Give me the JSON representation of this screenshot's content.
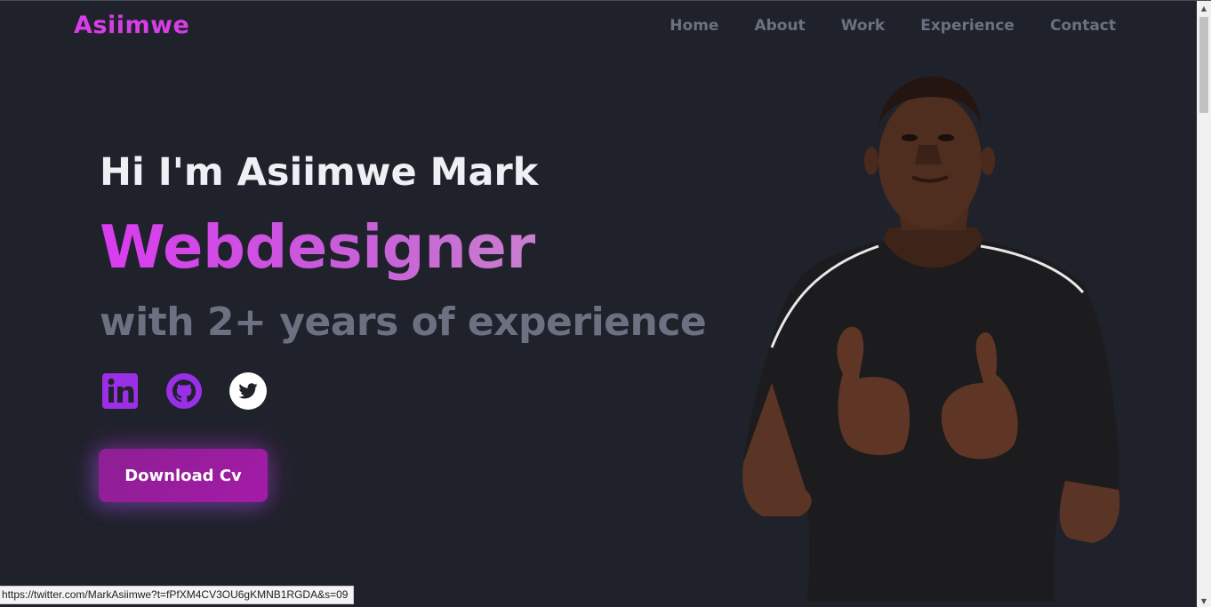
{
  "brand": {
    "logo": "Asiimwe"
  },
  "nav": [
    {
      "label": "Home"
    },
    {
      "label": "About"
    },
    {
      "label": "Work"
    },
    {
      "label": "Experience"
    },
    {
      "label": "Contact"
    }
  ],
  "hero": {
    "greeting": "Hi I'm Asiimwe Mark",
    "role": "Webdesigner",
    "subtitle": "with 2+ years of experience"
  },
  "socials": [
    {
      "icon": "linkedin-icon",
      "color": "#9b2fe8"
    },
    {
      "icon": "github-icon",
      "color": "#9b2fe8"
    },
    {
      "icon": "twitter-icon",
      "color": "#ffffff"
    }
  ],
  "cta": {
    "label": "Download Cv"
  },
  "status_bar": {
    "url": "https://twitter.com/MarkAsiimwe?t=fPfXM4CV3OU6gKMNB1RGDA&s=09"
  },
  "colors": {
    "accent": "#d63ee6",
    "muted": "#6b7180",
    "background": "#1f222b",
    "button": "#9a1c9f"
  }
}
